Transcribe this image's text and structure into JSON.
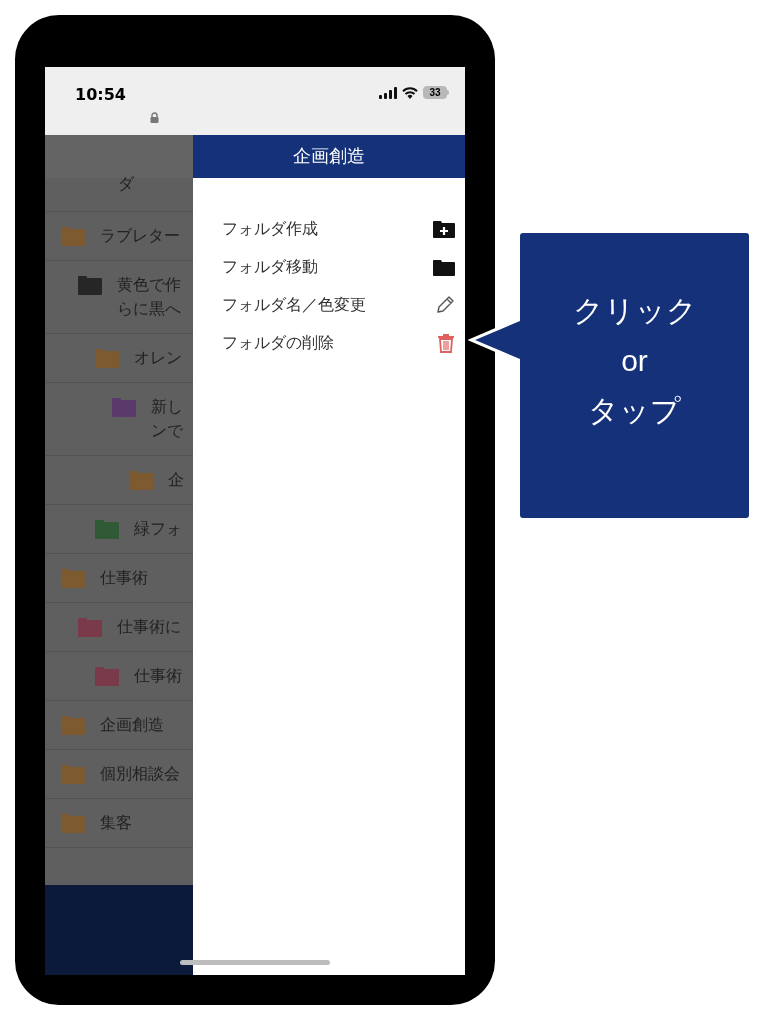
{
  "status_bar": {
    "time": "10:54",
    "battery": "33"
  },
  "folder_list": {
    "top_fragment": "ダ",
    "items": [
      {
        "lines": [
          "ラブレター"
        ],
        "color": "#7d5a30",
        "children": [
          {
            "lines": [
              "黄色で作",
              "らに黒へ"
            ],
            "color": "#262626",
            "children": [
              {
                "lines": [
                  "オレン"
                ],
                "color": "#7d5a30",
                "children": [
                  {
                    "lines": [
                      "新し",
                      "ンで"
                    ],
                    "color": "#5a3a6a",
                    "children": [
                      {
                        "lines": [
                          "企"
                        ],
                        "color": "#7d5a30"
                      }
                    ]
                  }
                ]
              },
              {
                "lines": [
                  "緑フォ"
                ],
                "color": "#2f5a35"
              }
            ]
          }
        ]
      },
      {
        "lines": [
          "仕事術"
        ],
        "color": "#7d5a30",
        "children": [
          {
            "lines": [
              "仕事術に"
            ],
            "color": "#7a3a4a",
            "children": [
              {
                "lines": [
                  "仕事術"
                ],
                "color": "#7a3a4a"
              }
            ]
          }
        ]
      },
      {
        "lines": [
          "企画創造"
        ],
        "color": "#7d5a30"
      },
      {
        "lines": [
          "個別相談会"
        ],
        "color": "#7d5a30"
      },
      {
        "lines": [
          "集客"
        ],
        "color": "#7d5a30"
      }
    ]
  },
  "drawer": {
    "title": "企画創造",
    "actions": [
      {
        "label": "フォルダ作成",
        "kind": "create"
      },
      {
        "label": "フォルダ移動",
        "kind": "move"
      },
      {
        "label": "フォルダ名／色変更",
        "kind": "rename"
      },
      {
        "label": "フォルダの削除",
        "kind": "delete"
      }
    ]
  },
  "callout": {
    "lines": [
      "クリック",
      "or",
      "タップ"
    ]
  }
}
